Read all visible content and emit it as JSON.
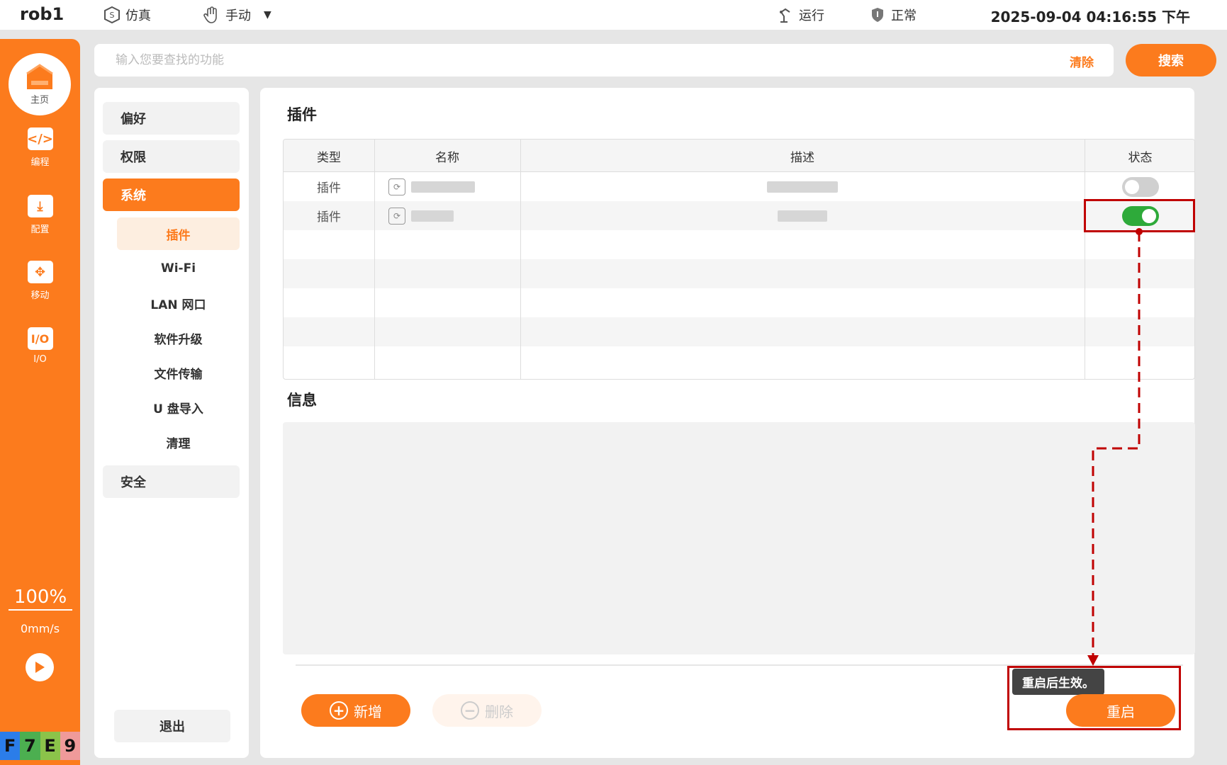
{
  "topbar": {
    "robot_name": "rob1",
    "mode_sim": "仿真",
    "mode_manual": "手动",
    "status_run": "运行",
    "status_normal": "正常",
    "datetime": "2025-09-04 04:16:55 下午"
  },
  "sidebar": {
    "home": "主页",
    "items": [
      {
        "label": "编程",
        "glyph": "</>"
      },
      {
        "label": "配置",
        "glyph": "⤓"
      },
      {
        "label": "移动",
        "glyph": "✥"
      },
      {
        "label": "I/O",
        "glyph": "I/O"
      }
    ],
    "speed_percent": "100%",
    "speed_value": "0mm/s",
    "keys": [
      {
        "char": "F",
        "color": "#2b7de9"
      },
      {
        "char": "7",
        "color": "#4caf50"
      },
      {
        "char": "E",
        "color": "#8bc34a"
      },
      {
        "char": "9",
        "color": "#ef9a9a"
      }
    ]
  },
  "search": {
    "placeholder": "输入您要查找的功能",
    "value": "",
    "clear_label": "清除",
    "search_label": "搜索"
  },
  "menu": {
    "categories": [
      "偏好",
      "权限",
      "系统",
      "安全"
    ],
    "sub_items": [
      "插件",
      "Wi-Fi",
      "LAN 网口",
      "软件升级",
      "文件传输",
      "U 盘导入",
      "清理"
    ],
    "exit_label": "退出"
  },
  "content": {
    "plugins_title": "插件",
    "columns": [
      "类型",
      "名称",
      "描述",
      "状态"
    ],
    "rows": [
      {
        "type": "插件",
        "enabled": false
      },
      {
        "type": "插件",
        "enabled": true
      }
    ],
    "info_title": "信息",
    "add_label": "新增",
    "delete_label": "删除",
    "restart_label": "重启",
    "tooltip": "重启后生效。"
  },
  "colors": {
    "accent": "#fc7b1d",
    "toggle_on": "#2eaa3a",
    "annotation": "#c00000"
  }
}
